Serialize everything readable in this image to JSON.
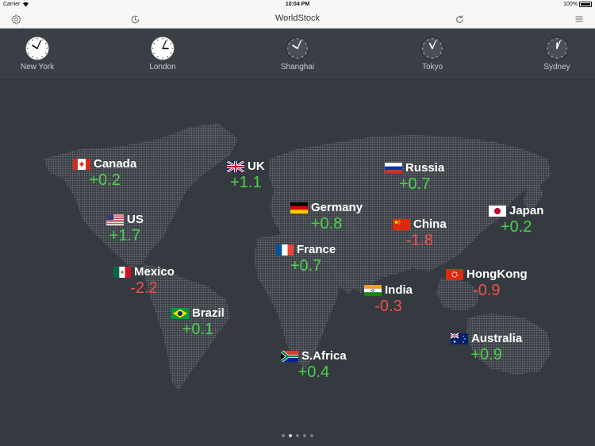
{
  "status": {
    "carrier": "Carrier",
    "time": "10:04 PM",
    "battery": "100%"
  },
  "nav": {
    "title": "WorldStock"
  },
  "clocks": [
    {
      "city": "New York",
      "hour": 10,
      "minute": 4,
      "day": true
    },
    {
      "city": "London",
      "hour": 3,
      "minute": 4,
      "day": true
    },
    {
      "city": "Shanghai",
      "hour": 10,
      "minute": 4,
      "day": false
    },
    {
      "city": "Tokyo",
      "hour": 11,
      "minute": 4,
      "day": false
    },
    {
      "city": "Sydney",
      "hour": 12,
      "minute": 4,
      "day": false
    }
  ],
  "markets": [
    {
      "name": "Canada",
      "change": "+0.2",
      "flag": "ca"
    },
    {
      "name": "UK",
      "change": "+1.1",
      "flag": "uk"
    },
    {
      "name": "Russia",
      "change": "+0.7",
      "flag": "ru"
    },
    {
      "name": "US",
      "change": "+1.7",
      "flag": "us"
    },
    {
      "name": "Germany",
      "change": "+0.8",
      "flag": "de"
    },
    {
      "name": "China",
      "change": "-1.8",
      "flag": "cn"
    },
    {
      "name": "Japan",
      "change": "+0.2",
      "flag": "jp"
    },
    {
      "name": "France",
      "change": "+0.7",
      "flag": "fr"
    },
    {
      "name": "Mexico",
      "change": "-2.2",
      "flag": "mx"
    },
    {
      "name": "HongKong",
      "change": "-0.9",
      "flag": "hk"
    },
    {
      "name": "India",
      "change": "-0.3",
      "flag": "in"
    },
    {
      "name": "Brazil",
      "change": "+0.1",
      "flag": "br"
    },
    {
      "name": "Australia",
      "change": "+0.9",
      "flag": "au"
    },
    {
      "name": "S.Africa",
      "change": "+0.4",
      "flag": "za"
    }
  ],
  "pager": {
    "count": 5,
    "active": 1
  },
  "colors": {
    "positive": "#4cd14c",
    "negative": "#f0504c",
    "background": "#353a40"
  }
}
